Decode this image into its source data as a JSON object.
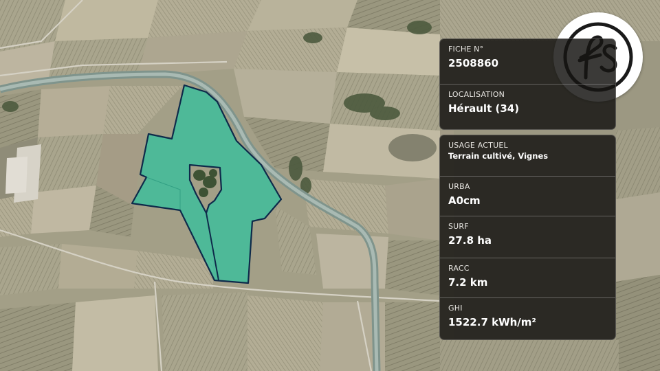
{
  "fiche": {
    "label": "FICHE N°",
    "value": "2508860"
  },
  "localisation": {
    "label": "LOCALISATION",
    "value": "Hérault (34)"
  },
  "usage": {
    "label": "USAGE ACTUEL",
    "value": "Terrain cultivé, Vignes"
  },
  "urba": {
    "label": "URBA",
    "value": "A0cm"
  },
  "surf": {
    "label": "SURF",
    "value": "27.8 ha"
  },
  "racc": {
    "label": "RACC",
    "value": "7.2 km"
  },
  "ghi": {
    "label": "GHI",
    "value": "1522.7 kWh/m²"
  },
  "logo": {
    "text": "fs",
    "icon": "fs-monogram-logo"
  },
  "colors": {
    "parcel_fill": "#2ec4a0",
    "parcel_stroke": "#0e2a4a",
    "panel_bg": "#161412",
    "canal": "#8fa7a0"
  }
}
